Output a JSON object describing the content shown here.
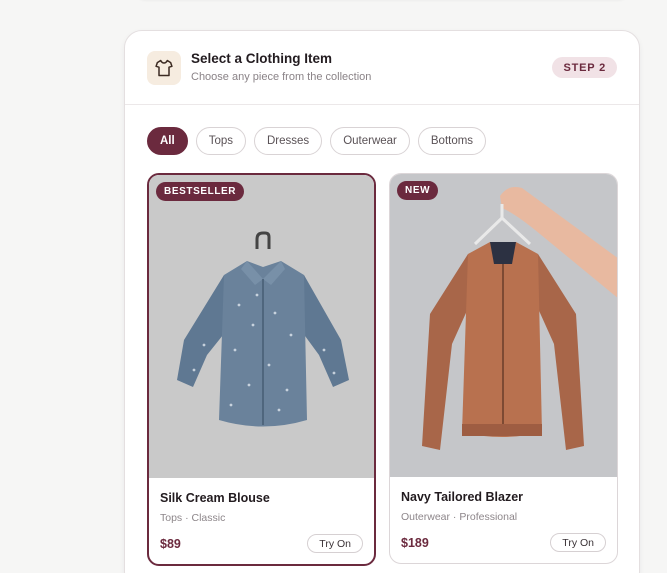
{
  "header": {
    "title": "Select a Clothing Item",
    "subtitle": "Choose any piece from the collection",
    "step": "STEP 2",
    "icon": "shirt-icon"
  },
  "filters": [
    {
      "label": "All",
      "active": true
    },
    {
      "label": "Tops",
      "active": false
    },
    {
      "label": "Dresses",
      "active": false
    },
    {
      "label": "Outerwear",
      "active": false
    },
    {
      "label": "Bottoms",
      "active": false
    }
  ],
  "products": [
    {
      "badge": "BESTSELLER",
      "name": "Silk Cream Blouse",
      "meta": "Tops · Classic",
      "price": "$89",
      "action": "Try On",
      "selected": true
    },
    {
      "badge": "NEW",
      "name": "Navy Tailored Blazer",
      "meta": "Outerwear · Professional",
      "price": "$189",
      "action": "Try On",
      "selected": false
    }
  ],
  "colors": {
    "accent": "#6b2a3e",
    "badge_bg": "#f1e2e6",
    "icon_bg": "#f6ece0"
  }
}
